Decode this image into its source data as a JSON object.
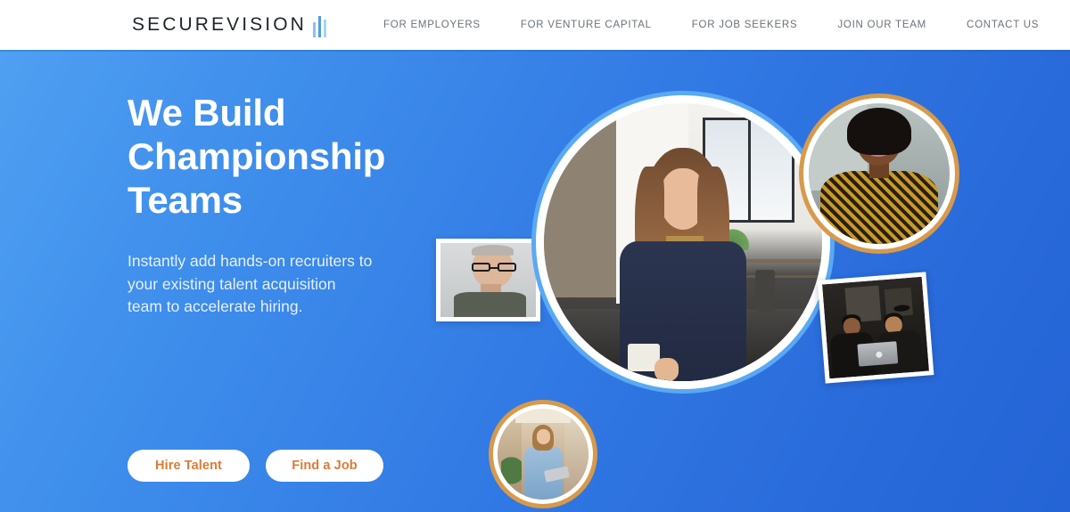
{
  "header": {
    "logo": {
      "word": "SECUREVISION",
      "mark_name": "bar-chart-mark",
      "bar_colors": [
        "#8cc0ec",
        "#4f9ede",
        "#a9d3f2"
      ]
    },
    "nav": [
      {
        "label": "FOR EMPLOYERS"
      },
      {
        "label": "FOR VENTURE CAPITAL"
      },
      {
        "label": "FOR JOB SEEKERS"
      },
      {
        "label": "JOIN OUR TEAM"
      },
      {
        "label": "CONTACT US"
      }
    ]
  },
  "hero": {
    "headline_line1": "We Build",
    "headline_line2": "Championship",
    "headline_line3": "Teams",
    "subcopy": "Instantly add hands-on recruiters to your existing talent acquisition team to accelerate hiring.",
    "buttons": [
      {
        "label": "Hire Talent"
      },
      {
        "label": "Find a Job"
      }
    ],
    "colors": {
      "gradient_start": "#4fa0f2",
      "gradient_end": "#2464d6",
      "button_text": "#dd7a35",
      "button_bg": "#ffffff",
      "headline_text": "#ffffff",
      "subcopy_text": "#e6f0fb",
      "main_circle_ring": "#5aa9f3",
      "gold_ring": "#d79a4b"
    },
    "photos": [
      {
        "name": "woman-in-office-main",
        "alt": "Smiling woman in navy blazer leaning on office wall",
        "frame": "circle",
        "ring": "blue"
      },
      {
        "name": "smiling-woman-portrait",
        "alt": "Smiling woman with patterned gold top",
        "frame": "circle",
        "ring": "gold"
      },
      {
        "name": "man-with-glasses",
        "alt": "Older man with glasses in grey shirt",
        "frame": "rectangle",
        "ring": "white"
      },
      {
        "name": "two-men-at-laptop",
        "alt": "Two men smiling at a laptop in a dark room",
        "frame": "rectangle",
        "ring": "white"
      },
      {
        "name": "woman-with-tablet",
        "alt": "Woman in light blue shirt holding a tablet in a corridor",
        "frame": "circle",
        "ring": "gold"
      }
    ]
  }
}
